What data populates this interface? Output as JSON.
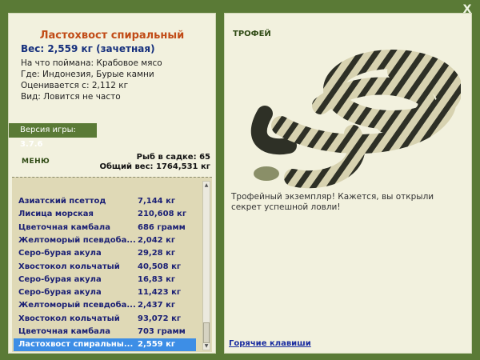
{
  "close_label": "X",
  "fish": {
    "title": "Ластохвост спиральный",
    "weight": "Вес: 2,559 кг (зачетная)",
    "bait": "На что поймана: Крабовое мясо",
    "place": "Где: Индонезия, Бурые камни",
    "price": "Оценивается с: 2,112 кг",
    "kind": "Вид: Ловится не часто"
  },
  "version": {
    "label": "Версия игры:",
    "value": "3.7.6"
  },
  "menu_label": "МЕНЮ",
  "stats": {
    "count": "Рыб в садке: 65",
    "total": "Общий вес: 1764,531 кг"
  },
  "list": [
    {
      "name": "Азиатский псеттод",
      "weight": "7,144 кг"
    },
    {
      "name": "Лисица морская",
      "weight": "210,608 кг"
    },
    {
      "name": "Цветочная камбала",
      "weight": "686 грамм"
    },
    {
      "name": "Желтоморый псевдоба...",
      "weight": "2,042 кг"
    },
    {
      "name": "Серо-бурая акула",
      "weight": "29,28 кг"
    },
    {
      "name": "Хвостокол кольчатый",
      "weight": "40,508 кг"
    },
    {
      "name": "Серо-бурая акула",
      "weight": "16,83 кг"
    },
    {
      "name": "Серо-бурая акула",
      "weight": "11,423 кг"
    },
    {
      "name": "Желтоморый псевдоба...",
      "weight": "2,437 кг"
    },
    {
      "name": "Хвостокол кольчатый",
      "weight": "93,072 кг"
    },
    {
      "name": "Цветочная камбала",
      "weight": "703 грамм"
    },
    {
      "name": "Ластохвост спиральны...",
      "weight": "2,559 кг"
    }
  ],
  "trophy": {
    "label": "ТРОФЕЙ",
    "text": "Трофейный экземпляр! Кажется, вы открыли секрет успешной ловли!"
  },
  "hotkeys": "Горячие клавиши",
  "colors": {
    "title": "#c14b16",
    "weight": "#16307d",
    "selection": "#3d8ee6",
    "frame": "#5a7a36"
  }
}
